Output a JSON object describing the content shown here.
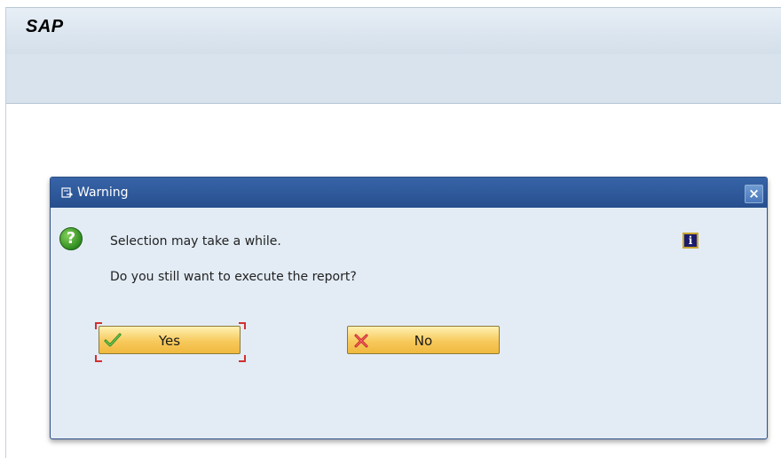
{
  "app": {
    "title": "SAP"
  },
  "dialog": {
    "title": "Warning",
    "messages": [
      "Selection may take a while.",
      "Do you still want to execute the report?"
    ],
    "buttons": {
      "yes": "Yes",
      "no": "No"
    },
    "close_label": "×",
    "info_label": "i",
    "question_label": "?"
  },
  "colors": {
    "header_start": "#e7eef6",
    "header_end": "#d3dfea",
    "dialog_title_bar": "#2f5fa5",
    "dialog_body": "#e3ecf5",
    "button_gradient_top": "#fff1b2",
    "button_gradient_bottom": "#f0b93f",
    "question_icon": "#2f8c1f",
    "info_icon": "#1c1c6b",
    "focus_marker": "#d32f2f"
  },
  "icons": {
    "question": "question-icon",
    "info": "info-icon",
    "confirm": "checkmark-icon",
    "cancel": "cross-icon",
    "dialog": "dialog-window-icon",
    "close": "close-icon"
  }
}
